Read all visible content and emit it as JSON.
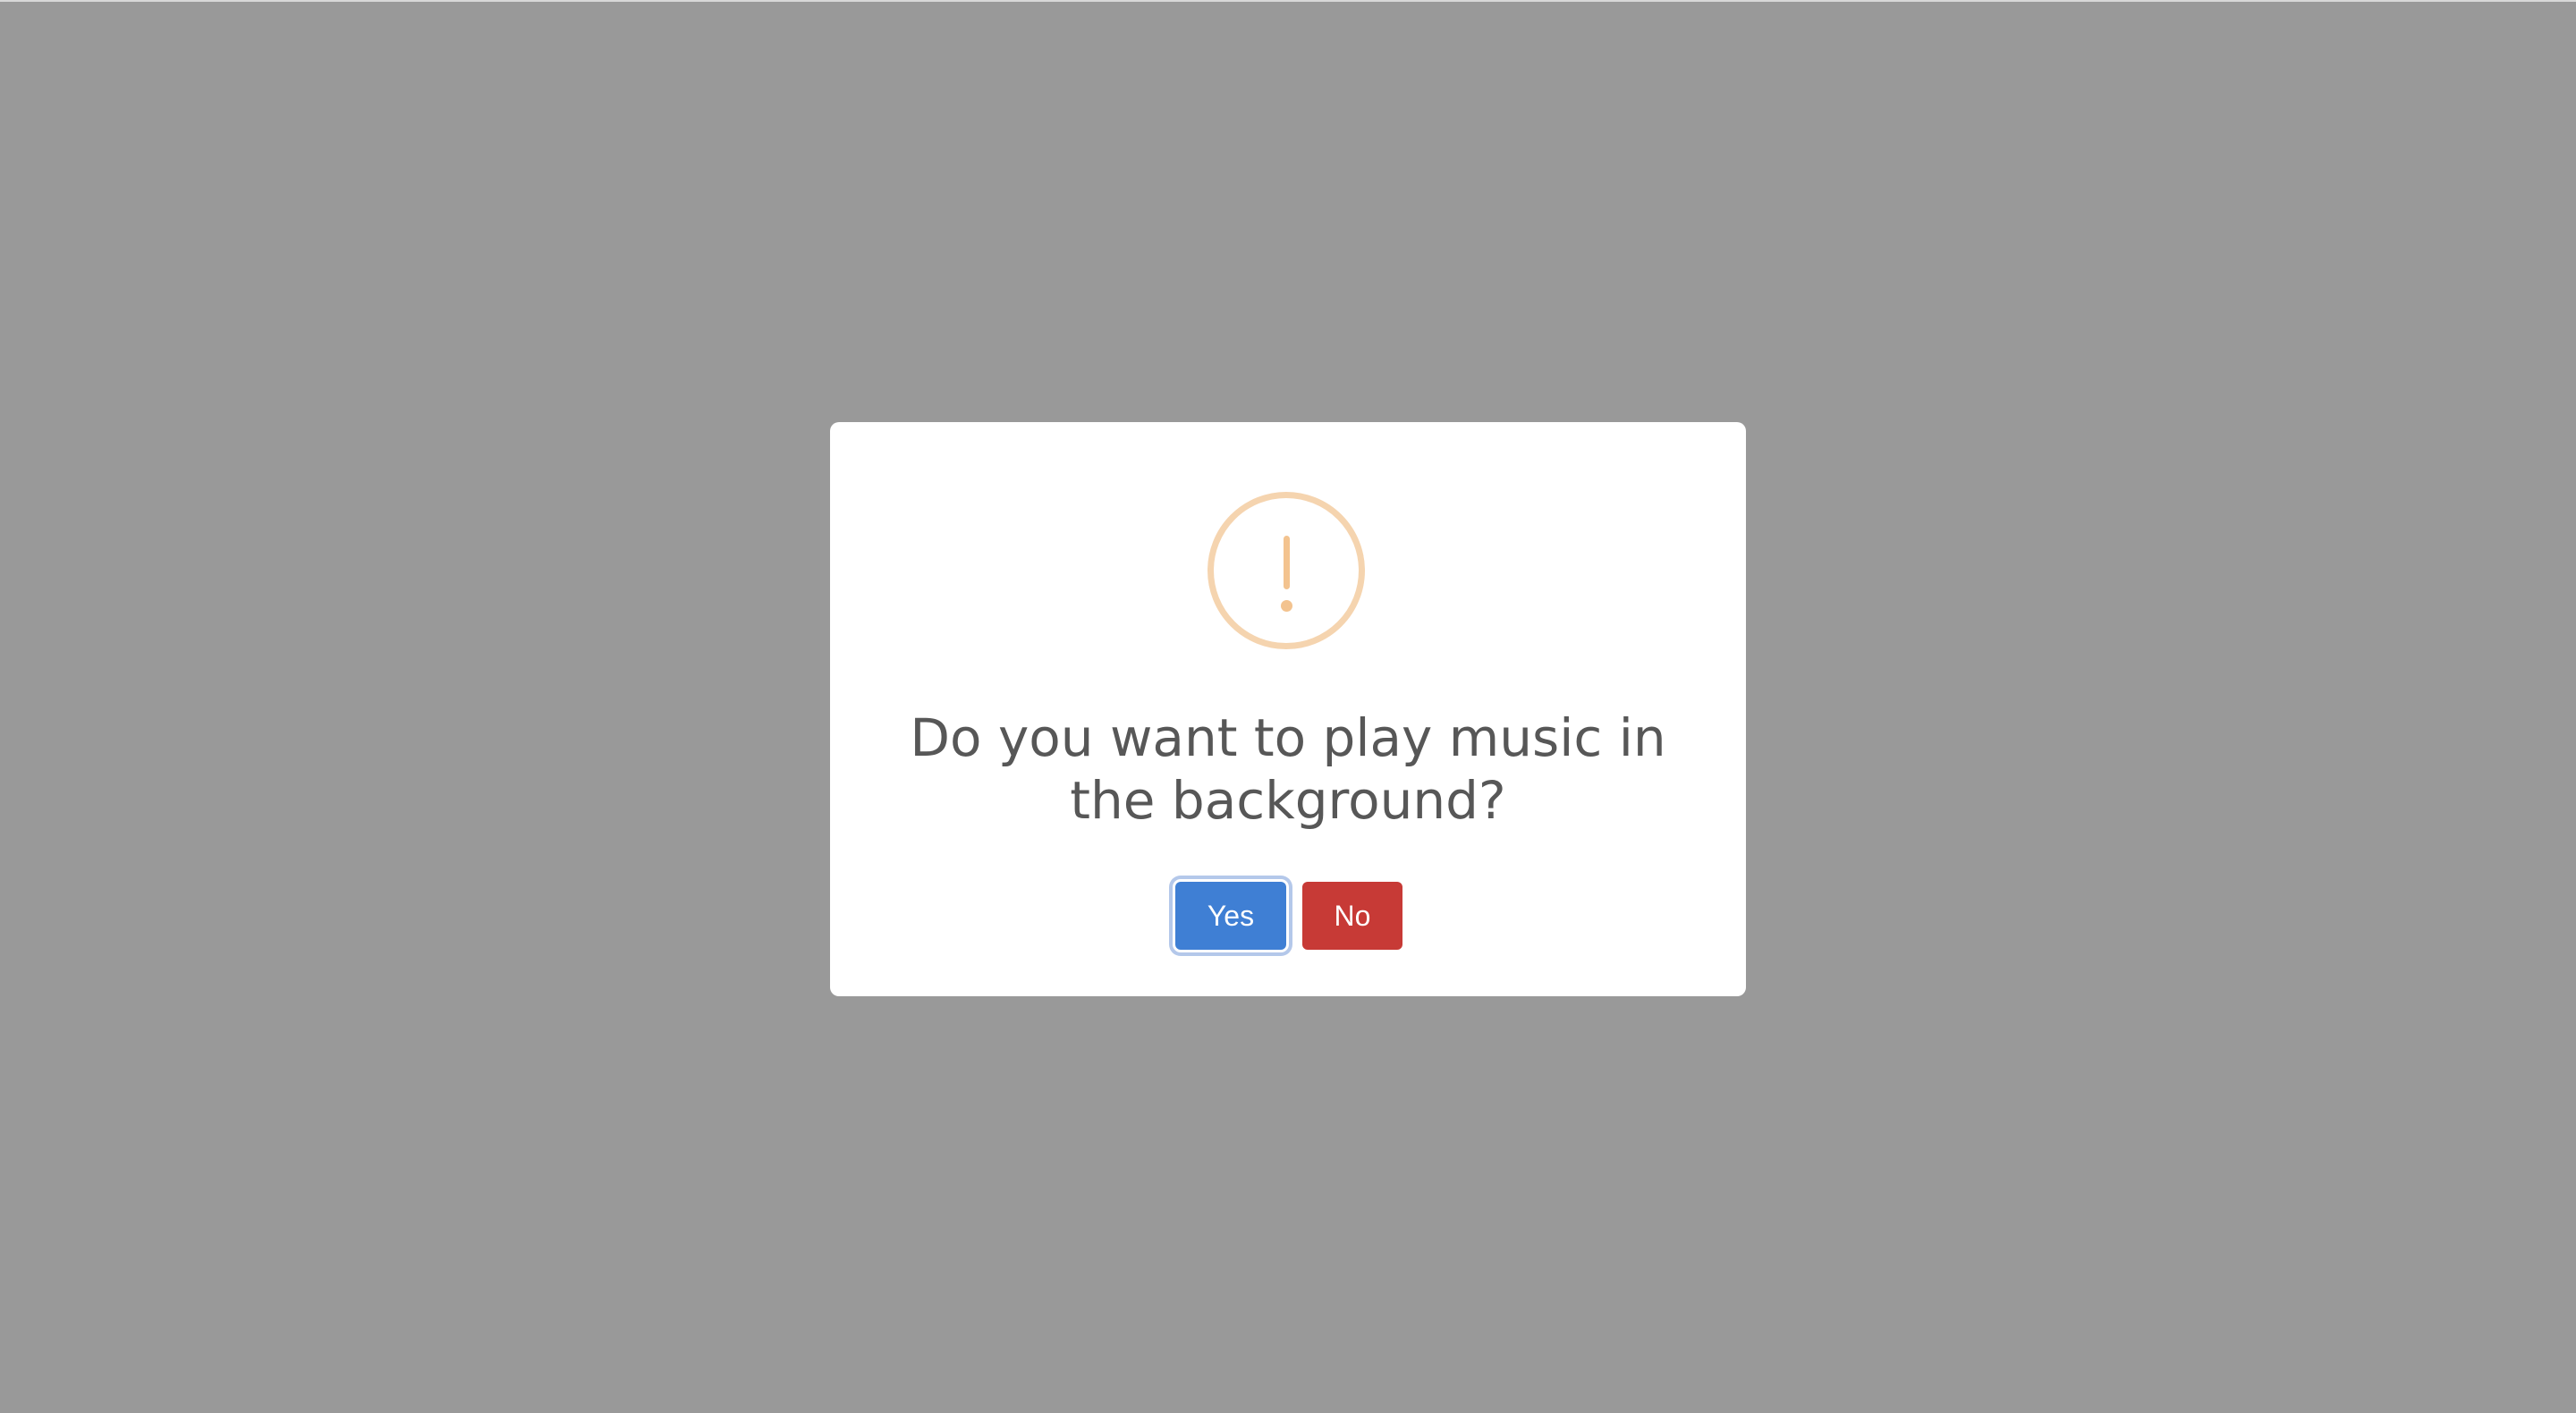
{
  "dialog": {
    "icon": "exclamation-icon",
    "title": "Do you want to play music in the background?",
    "confirm_label": "Yes",
    "cancel_label": "No"
  },
  "colors": {
    "overlay": "#999999",
    "dialog_background": "#ffffff",
    "icon_ring": "#f5d4af",
    "icon_mark": "#f3c38f",
    "title_text": "#575757",
    "confirm_button": "#3f7fd4",
    "cancel_button": "#c73a36"
  }
}
